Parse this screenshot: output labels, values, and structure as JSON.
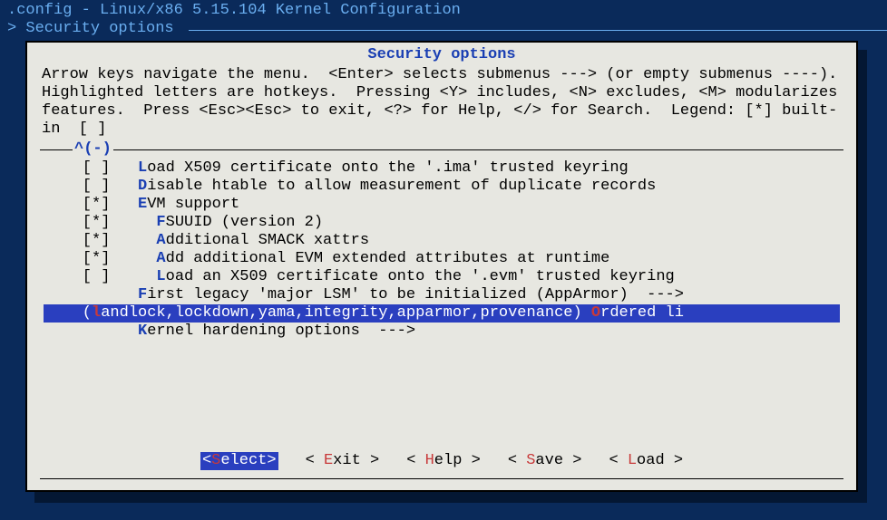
{
  "header": {
    "title": ".config - Linux/x86 5.15.104 Kernel Configuration",
    "breadcrumb": "> Security options "
  },
  "dialog": {
    "title": "Security options",
    "instructions": "Arrow keys navigate the menu.  <Enter> selects submenus ---> (or empty submenus ----).  Highlighted letters are hotkeys.  Pressing <Y> includes, <N> excludes, <M> modularizes features.  Press <Esc><Esc> to exit, <?> for Help, </> for Search.  Legend: [*] built-in  [ ]",
    "scroll_indicator": "^(-)"
  },
  "items": [
    {
      "prefix": "    [ ]   ",
      "hk": "L",
      "rest": "oad X509 certificate onto the '.ima' trusted keyring",
      "sel": false
    },
    {
      "prefix": "    [ ]   ",
      "hk": "D",
      "rest": "isable htable to allow measurement of duplicate records",
      "sel": false
    },
    {
      "prefix": "    [*]   ",
      "hk": "E",
      "rest": "VM support",
      "sel": false
    },
    {
      "prefix": "    [*]     ",
      "hk": "F",
      "rest": "SUUID (version 2)",
      "sel": false
    },
    {
      "prefix": "    [*]     ",
      "hk": "A",
      "rest": "dditional SMACK xattrs",
      "sel": false
    },
    {
      "prefix": "    [*]     ",
      "hk": "A",
      "rest": "dd additional EVM extended attributes at runtime",
      "sel": false
    },
    {
      "prefix": "    [ ]     ",
      "hk": "L",
      "rest": "oad an X509 certificate onto the '.evm' trusted keyring",
      "sel": false
    },
    {
      "prefix": "          ",
      "hk": "F",
      "rest": "irst legacy 'major LSM' to be initialized (AppArmor)  --->",
      "sel": false
    },
    {
      "prefix": "    (",
      "hk": "l",
      "rest": "andlock,lockdown,yama,integrity,apparmor,provenance) Ordered li",
      "sel": true,
      "hk2": "O",
      "split": "andlock,lockdown,yama,integrity,apparmor,provenance) ",
      "tail": "rdered li"
    },
    {
      "prefix": "          ",
      "hk": "K",
      "rest": "ernel hardening options  --->",
      "sel": false
    }
  ],
  "buttons": {
    "select": {
      "open": "<",
      "hk": "S",
      "rest": "elect",
      "close": ">",
      "active": true
    },
    "exit": {
      "open": "< ",
      "hk": "E",
      "rest": "xit ",
      "close": ">",
      "active": false
    },
    "help": {
      "open": "< ",
      "hk": "H",
      "rest": "elp ",
      "close": ">",
      "active": false
    },
    "save": {
      "open": "< ",
      "hk": "S",
      "rest": "ave ",
      "close": ">",
      "active": false
    },
    "load": {
      "open": "< ",
      "hk": "L",
      "rest": "oad ",
      "close": ">",
      "active": false
    }
  }
}
